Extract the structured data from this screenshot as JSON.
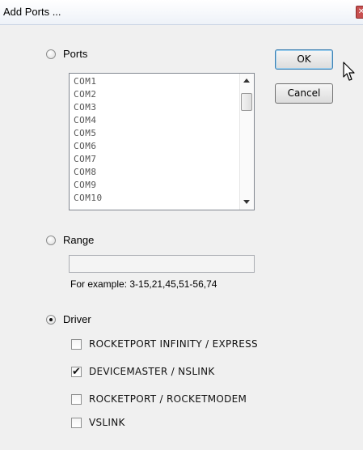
{
  "window": {
    "title": "Add Ports ...",
    "close_glyph": "✕"
  },
  "ports_option": {
    "label": "Ports",
    "selected": false
  },
  "ports_list": {
    "items": [
      "COM1",
      "COM2",
      "COM3",
      "COM4",
      "COM5",
      "COM6",
      "COM7",
      "COM8",
      "COM9",
      "COM10"
    ],
    "scroll_up_icon": "triangle-up",
    "scroll_down_icon": "triangle-down"
  },
  "buttons": {
    "ok": "OK",
    "cancel": "Cancel"
  },
  "range_option": {
    "label": "Range",
    "selected": false,
    "value": "",
    "hint": "For example: 3-15,21,45,51-56,74"
  },
  "driver_option": {
    "label": "Driver",
    "selected": true
  },
  "drivers": [
    {
      "label": "ROCKETPORT INFINITY / EXPRESS",
      "checked": false
    },
    {
      "label": "DEVICEMASTER / NSLINK",
      "checked": true
    },
    {
      "label": "ROCKETPORT / ROCKETMODEM",
      "checked": false
    },
    {
      "label": "VSLINK",
      "checked": false
    }
  ],
  "check_glyph": "✔"
}
